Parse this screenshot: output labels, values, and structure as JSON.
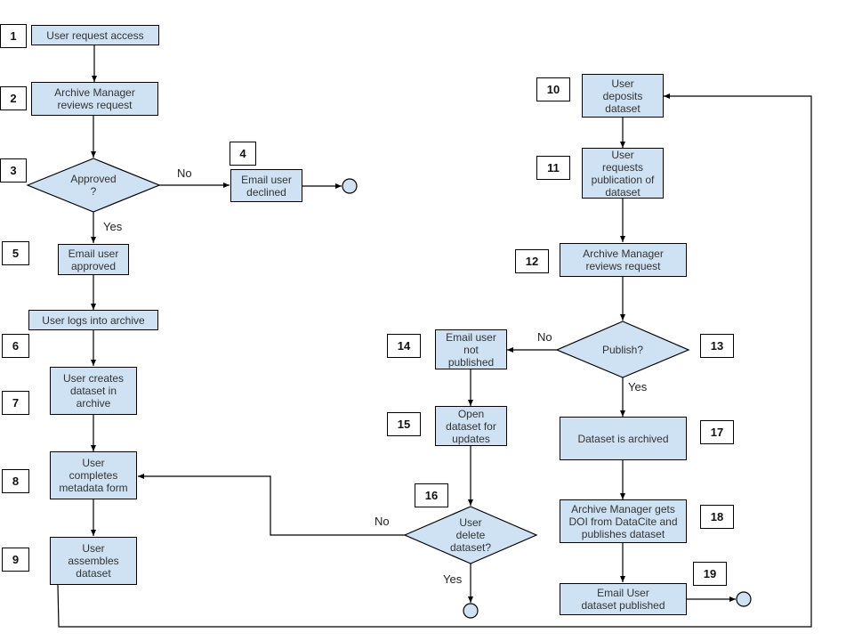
{
  "diagram": {
    "type": "flowchart",
    "colors": {
      "node_fill": "#cfe2f3",
      "stroke": "#000000",
      "background": "#ffffff"
    },
    "steps": [
      {
        "num": "1",
        "text": "User request access"
      },
      {
        "num": "2",
        "text": "Archive Manager\nreviews request"
      },
      {
        "num": "3",
        "text": "Approved\n?"
      },
      {
        "num": "4",
        "text": "Email user\ndeclined"
      },
      {
        "num": "5",
        "text": "Email user\napproved"
      },
      {
        "num": "6",
        "text": "User logs into archive"
      },
      {
        "num": "7",
        "text": "User creates\ndataset in\narchive"
      },
      {
        "num": "8",
        "text": "User\ncompletes\nmetadata form"
      },
      {
        "num": "9",
        "text": "User\nassembles\ndataset"
      },
      {
        "num": "10",
        "text": "User\ndeposits\ndataset"
      },
      {
        "num": "11",
        "text": "User\nrequests\npublication of\ndataset"
      },
      {
        "num": "12",
        "text": "Archive Manager\nreviews request"
      },
      {
        "num": "13",
        "text": "Publish?"
      },
      {
        "num": "14",
        "text": "Email user\nnot\npublished"
      },
      {
        "num": "15",
        "text": "Open\ndataset for\nupdates"
      },
      {
        "num": "16",
        "text": "User\ndelete\ndataset?"
      },
      {
        "num": "17",
        "text": "Dataset is archived"
      },
      {
        "num": "18",
        "text": "Archive Manager gets\nDOI from DataCite and\npublishes dataset"
      },
      {
        "num": "19",
        "text": "Email User\ndataset published"
      }
    ],
    "edge_labels": {
      "approved_no": "No",
      "approved_yes": "Yes",
      "publish_no": "No",
      "publish_yes": "Yes",
      "delete_no": "No",
      "delete_yes": "Yes"
    },
    "edges": [
      {
        "from": "1",
        "to": "2"
      },
      {
        "from": "2",
        "to": "3"
      },
      {
        "from": "3",
        "to": "4",
        "label": "No"
      },
      {
        "from": "4",
        "to": "end"
      },
      {
        "from": "3",
        "to": "5",
        "label": "Yes"
      },
      {
        "from": "5",
        "to": "6"
      },
      {
        "from": "6",
        "to": "7"
      },
      {
        "from": "7",
        "to": "8"
      },
      {
        "from": "8",
        "to": "9"
      },
      {
        "from": "9",
        "to": "10"
      },
      {
        "from": "10",
        "to": "11"
      },
      {
        "from": "11",
        "to": "12"
      },
      {
        "from": "12",
        "to": "13"
      },
      {
        "from": "13",
        "to": "14",
        "label": "No"
      },
      {
        "from": "14",
        "to": "15"
      },
      {
        "from": "15",
        "to": "16"
      },
      {
        "from": "16",
        "to": "8",
        "label": "No"
      },
      {
        "from": "16",
        "to": "end",
        "label": "Yes"
      },
      {
        "from": "13",
        "to": "17",
        "label": "Yes"
      },
      {
        "from": "17",
        "to": "18"
      },
      {
        "from": "18",
        "to": "19"
      },
      {
        "from": "19",
        "to": "end"
      }
    ]
  }
}
